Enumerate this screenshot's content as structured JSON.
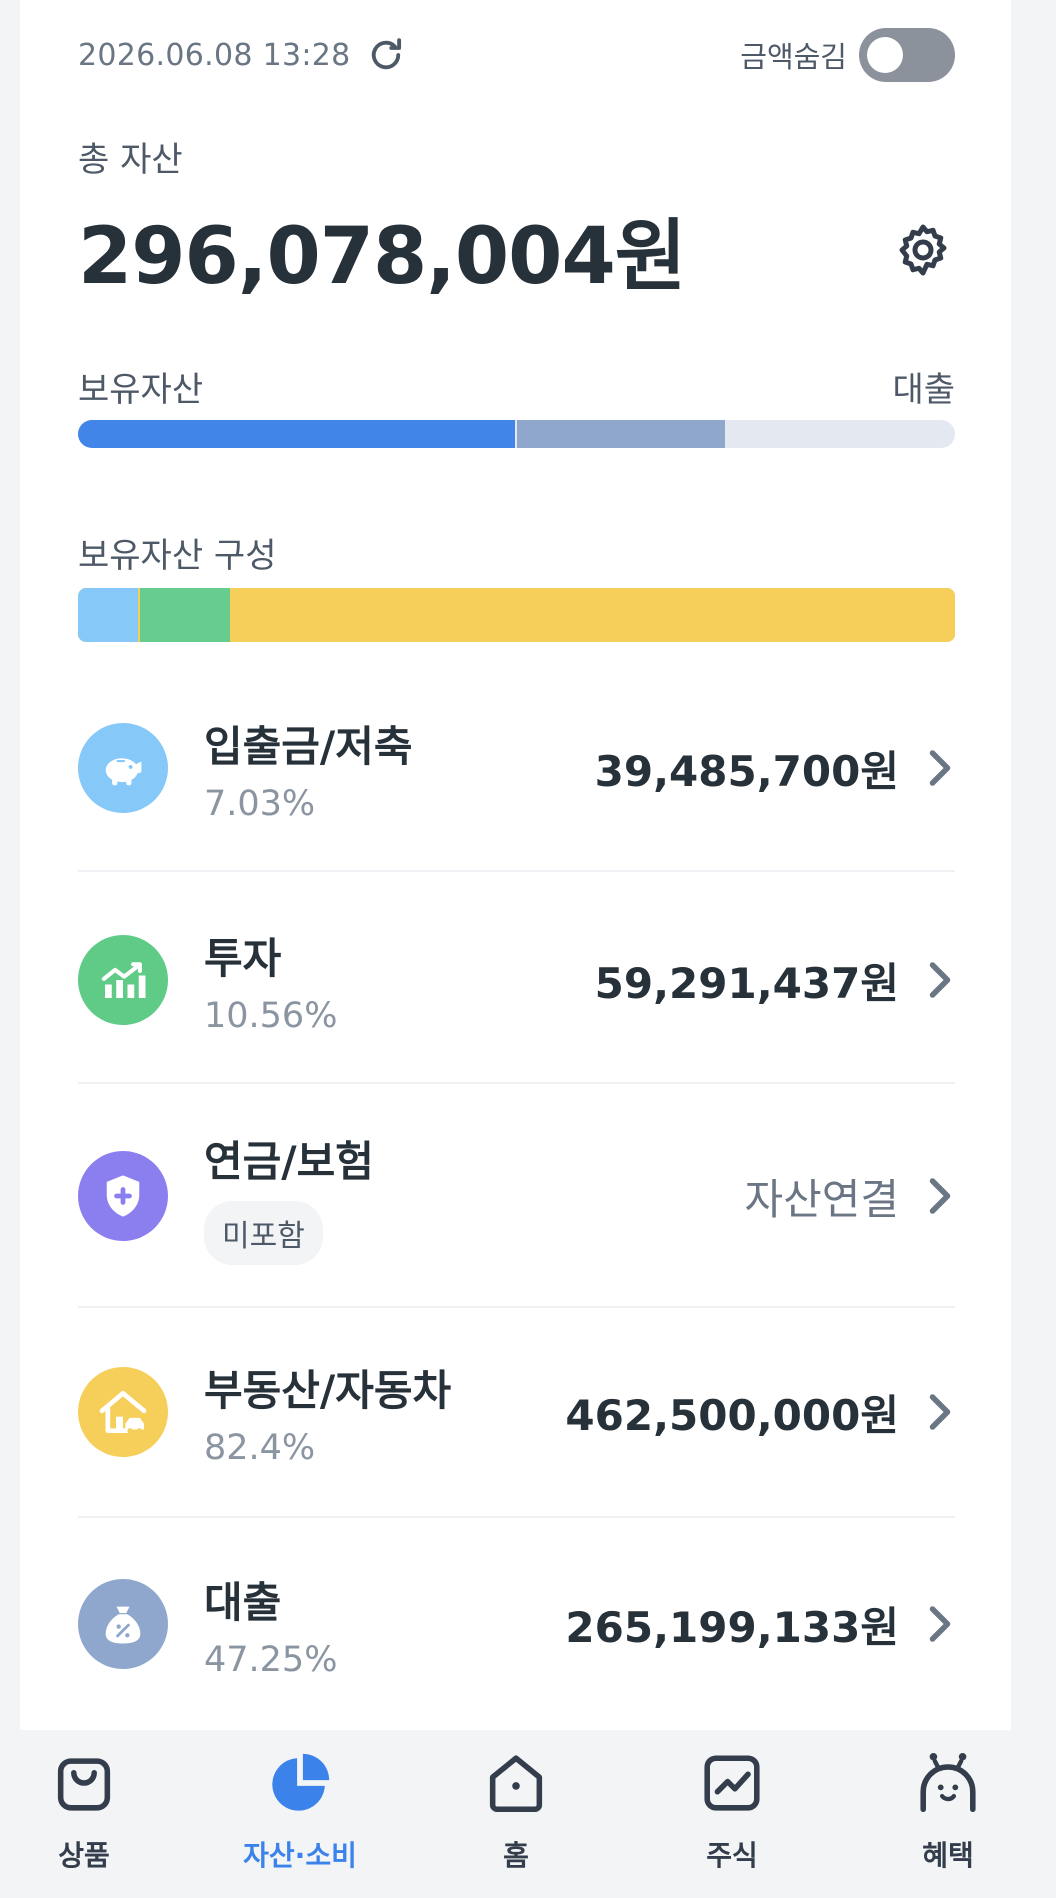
{
  "header": {
    "timestamp": "2026.06.08 13:28",
    "hide_amount_label": "금액숨김",
    "hide_amount_on": false
  },
  "total": {
    "label": "총 자산",
    "amount": "296,078,004원"
  },
  "asset_bar": {
    "left_label": "보유자산",
    "right_label": "대출",
    "segments": [
      {
        "fraction": 0.5,
        "color": "#4285e8"
      },
      {
        "fraction": 0.238,
        "color": "#8fa7cc"
      }
    ],
    "track_color": "#e3e8f1"
  },
  "composition": {
    "label": "보유자산 구성",
    "segments": [
      {
        "fraction": 0.0703,
        "color": "#86c8f7"
      },
      {
        "fraction": 0.1056,
        "color": "#66cd8e"
      },
      {
        "fraction": 0.8241,
        "color": "#f6cf5a"
      }
    ]
  },
  "items": [
    {
      "title": "입출금/저축",
      "sub": "7.03%",
      "amount": "39,485,700원",
      "icon": "piggy-bank-icon",
      "color": "#86c8f7"
    },
    {
      "title": "투자",
      "sub": "10.56%",
      "amount": "59,291,437원",
      "icon": "chart-up-icon",
      "color": "#5fcb87"
    },
    {
      "title": "연금/보험",
      "badge": "미포함",
      "amount": "자산연결",
      "icon": "shield-plus-icon",
      "color": "#8b7ff0"
    },
    {
      "title": "부동산/자동차",
      "sub": "82.4%",
      "amount": "462,500,000원",
      "icon": "house-car-icon",
      "color": "#f6cf5a"
    },
    {
      "title": "대출",
      "sub": "47.25%",
      "amount": "265,199,133원",
      "icon": "loan-bag-icon",
      "color": "#8fa7cc"
    }
  ],
  "nav": [
    {
      "label": "상품",
      "icon": "shopping-bag-icon",
      "active": false
    },
    {
      "label": "자산·소비",
      "icon": "pie-chart-icon",
      "active": true
    },
    {
      "label": "홈",
      "icon": "home-icon",
      "active": false
    },
    {
      "label": "주식",
      "icon": "stock-chart-icon",
      "active": false
    },
    {
      "label": "혜택",
      "icon": "character-icon",
      "active": false
    }
  ],
  "colors": {
    "accent": "#3b82ea",
    "text_primary": "#27313a",
    "text_secondary": "#8b95a1"
  }
}
